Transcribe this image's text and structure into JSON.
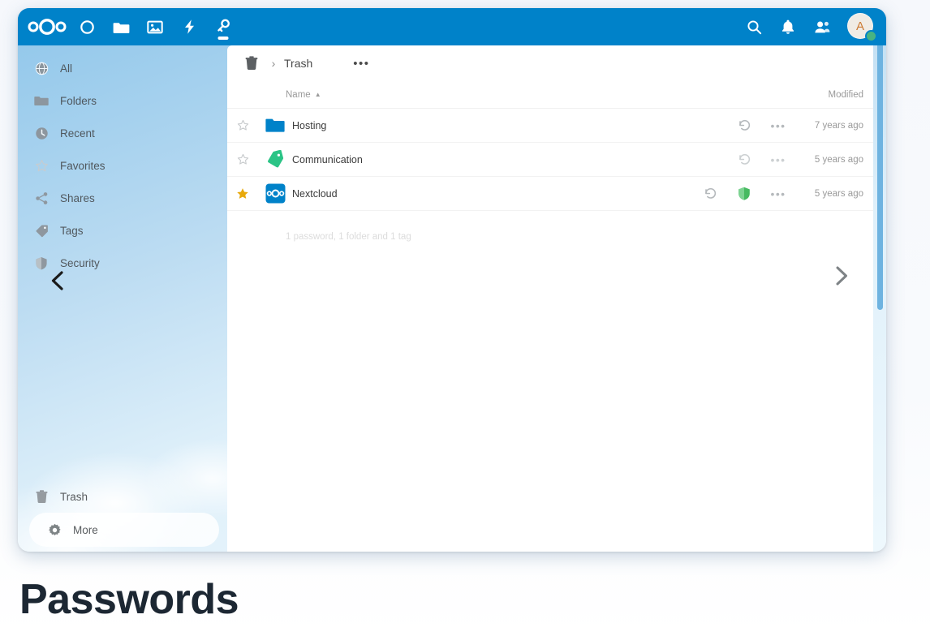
{
  "header": {
    "logo_icon": "nextcloud-logo",
    "apps": [
      {
        "name": "dashboard",
        "icon": "circle-icon",
        "active": false
      },
      {
        "name": "files",
        "icon": "folder-icon",
        "active": false
      },
      {
        "name": "photos",
        "icon": "image-icon",
        "active": false
      },
      {
        "name": "activity",
        "icon": "lightning-icon",
        "active": false
      },
      {
        "name": "passwords",
        "icon": "key-icon",
        "active": true
      }
    ],
    "right_icons": [
      {
        "name": "search",
        "icon": "magnifier-icon"
      },
      {
        "name": "notifications",
        "icon": "bell-icon"
      },
      {
        "name": "contacts",
        "icon": "contacts-icon"
      }
    ],
    "avatar_letter": "A",
    "avatar_status": "online",
    "brand_color": "#0082c9",
    "status_color": "#49b382"
  },
  "sidebar": {
    "items": [
      {
        "label": "All",
        "icon": "globe-icon"
      },
      {
        "label": "Folders",
        "icon": "folder-icon"
      },
      {
        "label": "Recent",
        "icon": "clock-icon"
      },
      {
        "label": "Favorites",
        "icon": "star-outline-icon"
      },
      {
        "label": "Shares",
        "icon": "share-icon"
      },
      {
        "label": "Tags",
        "icon": "tag-icon"
      },
      {
        "label": "Security",
        "icon": "shield-icon"
      }
    ],
    "bottom_items": [
      {
        "label": "Trash",
        "icon": "trash-icon",
        "active": false
      },
      {
        "label": "More",
        "icon": "gear-icon",
        "active": true
      }
    ],
    "collapse_icon": "chevron-left-icon"
  },
  "content": {
    "breadcrumb": {
      "root_icon": "trash-icon",
      "separator": "›",
      "label": "Trash",
      "more_label": "•••"
    },
    "columns": {
      "name": "Name",
      "sort_caret": "▲",
      "modified": "Modified"
    },
    "rows": [
      {
        "name": "Hosting",
        "icon": "folder-blue-icon",
        "favorite": false,
        "has_security": false,
        "restore_icon": "restore-icon",
        "menu_label": "•••",
        "modified": "7 years ago"
      },
      {
        "name": "Communication",
        "icon": "tag-green-icon",
        "favorite": false,
        "has_security": false,
        "restore_icon": "restore-icon",
        "menu_label": "•••",
        "modified": "5 years ago"
      },
      {
        "name": "Nextcloud",
        "icon": "nextcloud-favicon",
        "favorite": true,
        "has_security": true,
        "restore_icon": "restore-icon",
        "menu_label": "•••",
        "modified": "5 years ago"
      }
    ],
    "summary": "1 password, 1 folder and 1 tag",
    "next_page_icon": "chevron-right-icon"
  },
  "page_title": "Passwords",
  "colors": {
    "folder_blue": "#0082c9",
    "tag_green": "#2bc486",
    "favorite_gold": "#e8a90c",
    "shield_green": "#46ba61",
    "scrollbar": "#6eb3e0"
  }
}
